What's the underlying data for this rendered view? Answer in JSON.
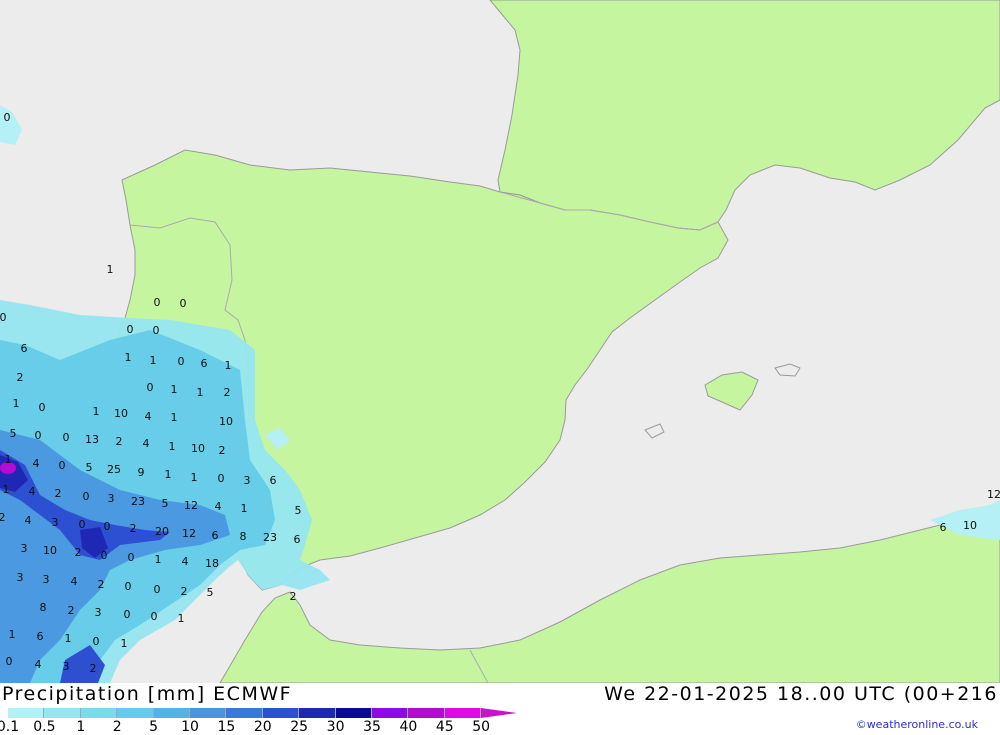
{
  "header": {
    "title": "Precipitation [mm] ECMWF",
    "datetime": "We 22-01-2025 18..00 UTC (00+216"
  },
  "credit": "©weatheronline.co.uk",
  "legend": {
    "items": [
      {
        "label": "0.1",
        "color": "#b4f0f5"
      },
      {
        "label": "0.5",
        "color": "#96e6f0"
      },
      {
        "label": "1",
        "color": "#78dcec"
      },
      {
        "label": "2",
        "color": "#64cbe8"
      },
      {
        "label": "5",
        "color": "#50b4e6"
      },
      {
        "label": "10",
        "color": "#4a96e0"
      },
      {
        "label": "15",
        "color": "#3c78dc"
      },
      {
        "label": "20",
        "color": "#2d50d2"
      },
      {
        "label": "25",
        "color": "#1e28b4"
      },
      {
        "label": "30",
        "color": "#0a0a96"
      },
      {
        "label": "35",
        "color": "#8c0ae6"
      },
      {
        "label": "40",
        "color": "#b40ad2"
      },
      {
        "label": "45",
        "color": "#dc0ae6"
      },
      {
        "label": "50",
        "color": "#c814c8"
      }
    ]
  },
  "colors": {
    "sea": "#ececec",
    "land": "#c6f5a0",
    "coast": "#9a9a9a",
    "border": "#aaaaaa"
  },
  "values": [
    "0",
    "1",
    "0",
    "0",
    "0",
    "0",
    "0",
    "6",
    "1",
    "1",
    "0",
    "6",
    "1",
    "2",
    "0",
    "1",
    "1",
    "2",
    "1",
    "0",
    "1",
    "10",
    "4",
    "1",
    "10",
    "5",
    "0",
    "0",
    "13",
    "2",
    "4",
    "1",
    "10",
    "2",
    "1",
    "4",
    "0",
    "5",
    "25",
    "9",
    "1",
    "1",
    "0",
    "3",
    "6",
    "1",
    "4",
    "2",
    "0",
    "3",
    "23",
    "5",
    "12",
    "4",
    "1",
    "5",
    "2",
    "4",
    "3",
    "0",
    "0",
    "2",
    "20",
    "12",
    "6",
    "8",
    "23",
    "6",
    "3",
    "10",
    "2",
    "0",
    "0",
    "1",
    "4",
    "18",
    "3",
    "3",
    "4",
    "2",
    "0",
    "0",
    "2",
    "5",
    "8",
    "2",
    "3",
    "0",
    "0",
    "1",
    "1",
    "6",
    "1",
    "0",
    "1",
    "0",
    "4",
    "3",
    "2",
    "2",
    "6",
    "10",
    "12",
    "0",
    "1",
    "0",
    "0"
  ]
}
